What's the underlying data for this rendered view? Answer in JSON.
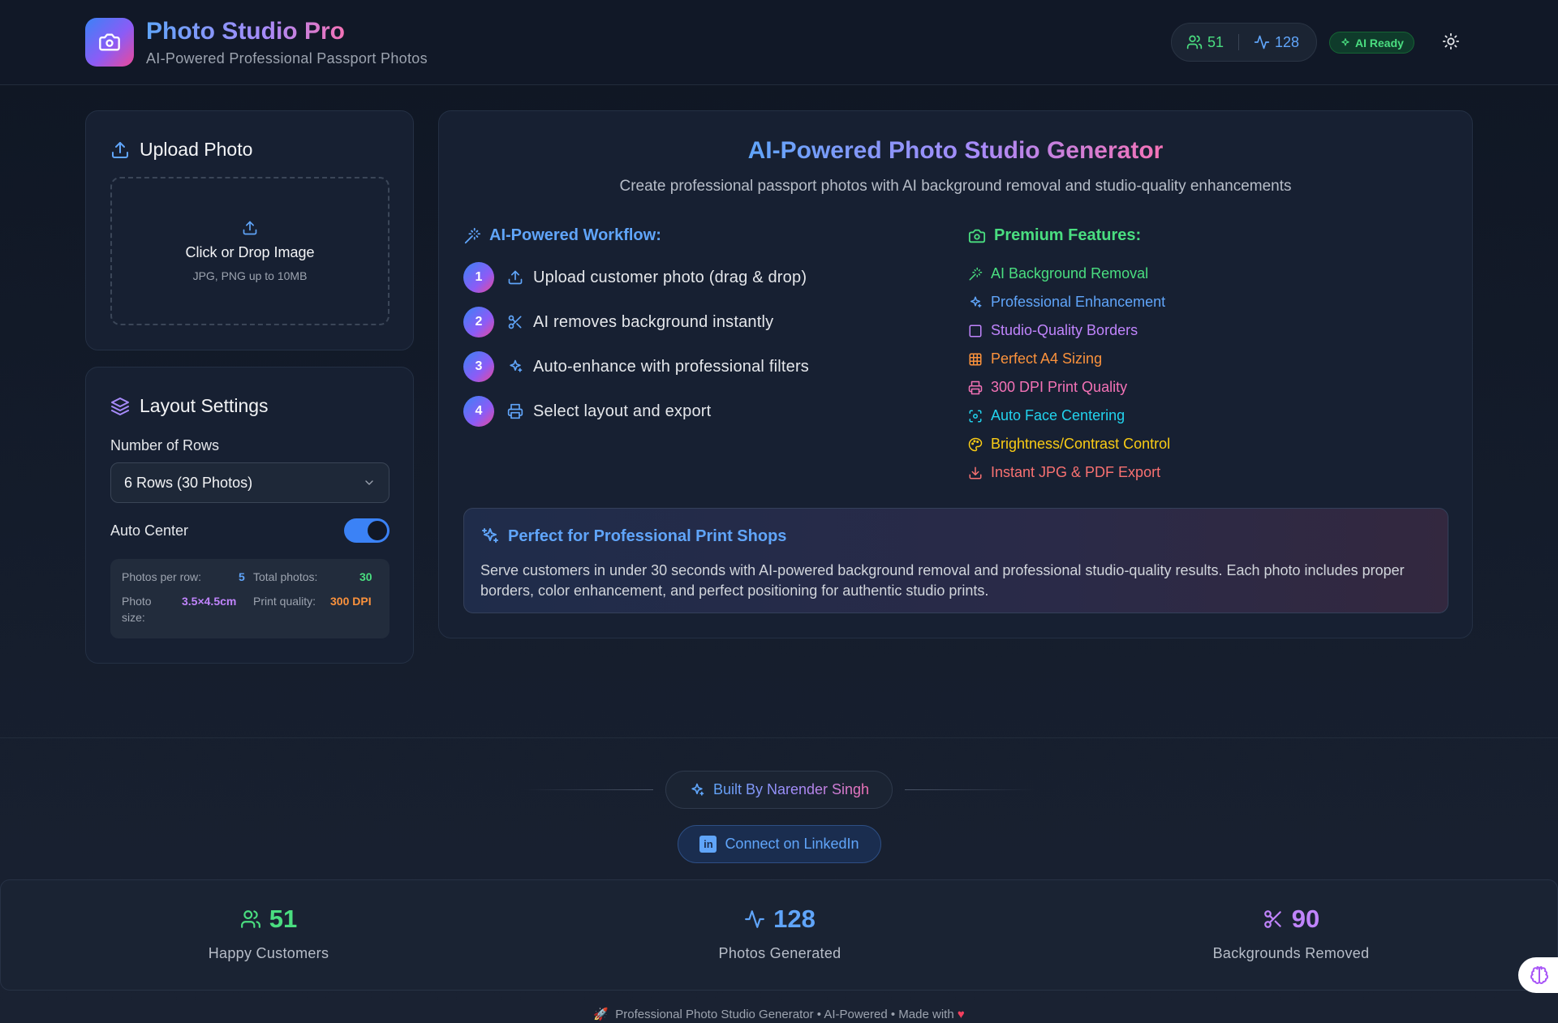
{
  "header": {
    "title": "Photo Studio Pro",
    "subtitle": "AI-Powered Professional Passport Photos",
    "customers_count": "51",
    "photos_count": "128",
    "ai_badge": "AI Ready"
  },
  "upload": {
    "title": "Upload Photo",
    "drop_title": "Click or Drop Image",
    "drop_sub": "JPG, PNG up to 10MB"
  },
  "layout": {
    "title": "Layout Settings",
    "rows_label": "Number of Rows",
    "rows_value": "6 Rows (30 Photos)",
    "auto_center_label": "Auto Center",
    "auto_center_on": true,
    "info": {
      "per_row_label": "Photos per row:",
      "per_row_value": "5",
      "total_label": "Total photos:",
      "total_value": "30",
      "size_label_1": "Photo",
      "size_label_2": "size:",
      "size_value": "3.5×4.5cm",
      "quality_label": "Print quality:",
      "quality_value": "300 DPI"
    }
  },
  "main": {
    "title": "AI-Powered Photo Studio Generator",
    "subtitle": "Create professional passport photos with AI background removal and studio-quality enhancements",
    "workflow_title": "AI-Powered Workflow:",
    "steps": [
      {
        "num": "1",
        "text": "Upload customer photo (drag & drop)",
        "icon": "upload-icon"
      },
      {
        "num": "2",
        "text": "AI removes background instantly",
        "icon": "scissors-icon"
      },
      {
        "num": "3",
        "text": "Auto-enhance with professional filters",
        "icon": "sparkles-icon"
      },
      {
        "num": "4",
        "text": "Select layout and export",
        "icon": "printer-icon"
      }
    ],
    "features_title": "Premium Features:",
    "features": [
      {
        "text": "AI Background Removal",
        "icon": "wand-icon",
        "color": "#4ade80"
      },
      {
        "text": "Professional Enhancement",
        "icon": "sparkles-icon",
        "color": "#60a5fa"
      },
      {
        "text": "Studio-Quality Borders",
        "icon": "square-icon",
        "color": "#c084fc"
      },
      {
        "text": "Perfect A4 Sizing",
        "icon": "grid-icon",
        "color": "#fb923c"
      },
      {
        "text": "300 DPI Print Quality",
        "icon": "printer-icon",
        "color": "#f472b6"
      },
      {
        "text": "Auto Face Centering",
        "icon": "scan-face-icon",
        "color": "#22d3ee"
      },
      {
        "text": "Brightness/Contrast Control",
        "icon": "palette-icon",
        "color": "#facc15"
      },
      {
        "text": "Instant JPG & PDF Export",
        "icon": "download-icon",
        "color": "#f87171"
      }
    ],
    "callout_title": "Perfect for Professional Print Shops",
    "callout_body": "Serve customers in under 30 seconds with AI-powered background removal and professional studio-quality results. Each photo includes proper borders, color enhancement, and perfect positioning for authentic studio prints."
  },
  "footer": {
    "built_by": "Built By Narender Singh",
    "linkedin": "Connect on LinkedIn",
    "linkedin_badge": "in",
    "stats": [
      {
        "value": "51",
        "label": "Happy Customers",
        "icon": "users-icon",
        "color": "#4ade80"
      },
      {
        "value": "128",
        "label": "Photos Generated",
        "icon": "activity-icon",
        "color": "#60a5fa"
      },
      {
        "value": "90",
        "label": "Backgrounds Removed",
        "icon": "scissors-icon",
        "color": "#c084fc"
      }
    ],
    "bottom": "Professional Photo Studio Generator  •  AI-Powered  •  Made with",
    "rocket": "🚀",
    "heart": "♥"
  },
  "colors": {
    "accent_blue": "#3b82f6",
    "accent_purple": "#8b5cf6",
    "accent_pink": "#ec4899",
    "success": "#4ade80"
  }
}
